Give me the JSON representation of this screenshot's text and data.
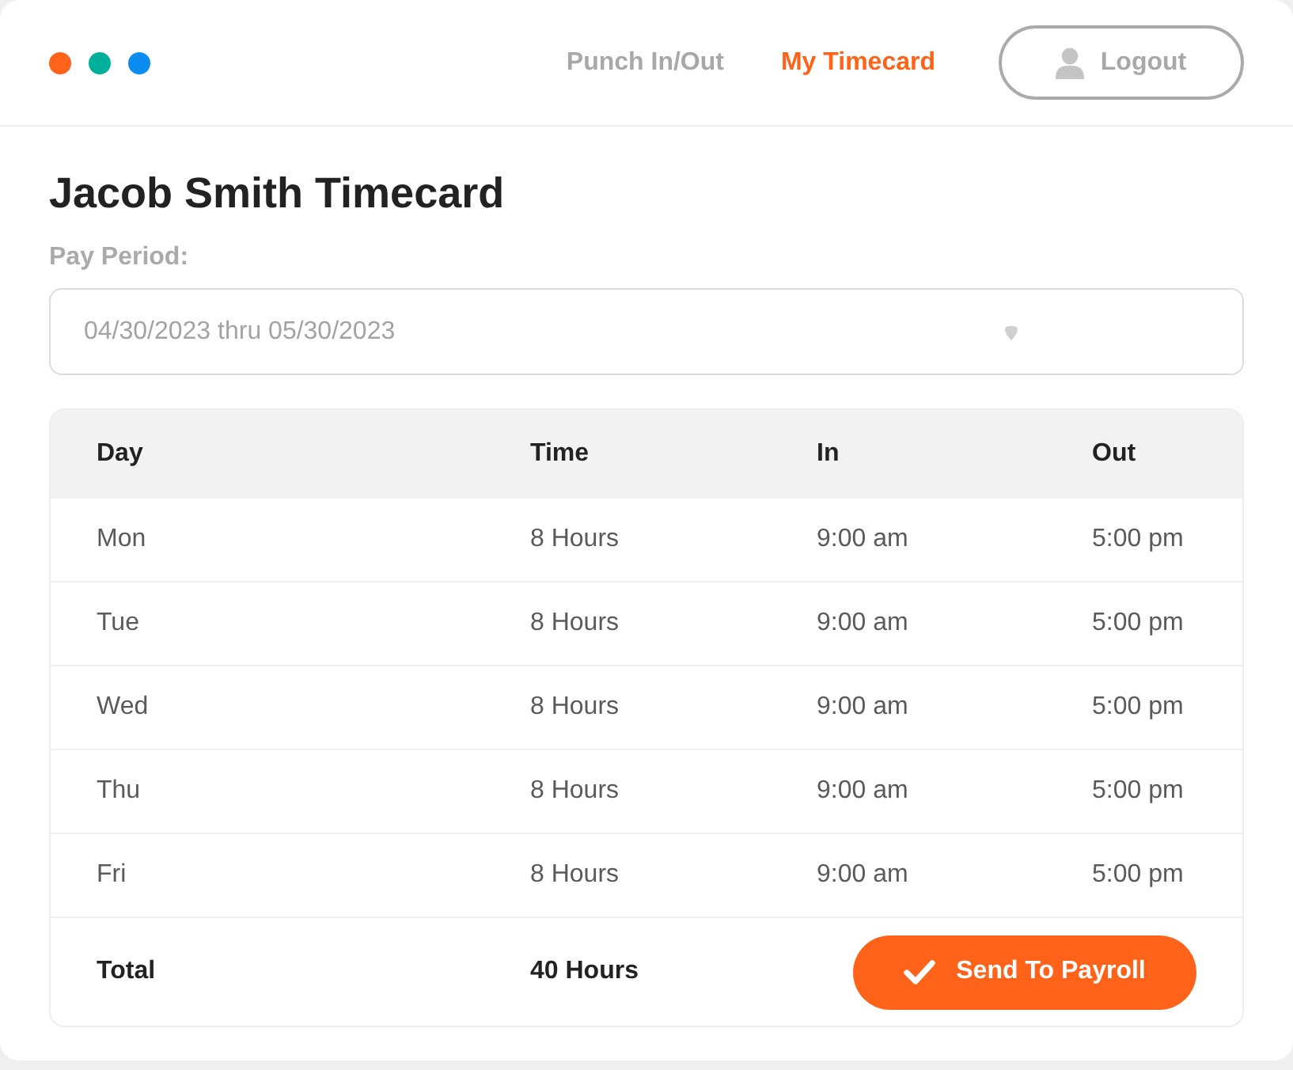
{
  "nav": {
    "items": [
      {
        "label": "Punch In/Out",
        "selected": false
      },
      {
        "label": "My Timecard",
        "selected": true
      }
    ],
    "logout": "Logout"
  },
  "page": {
    "title": "Jacob Smith Timecard"
  },
  "pay_period": {
    "label": "Pay Period:",
    "value": "04/30/2023 thru 05/30/2023"
  },
  "table": {
    "columns": [
      "Day",
      "Time",
      "In",
      "Out"
    ],
    "rows": [
      [
        "Mon",
        "8 Hours",
        "9:00 am",
        "5:00 pm"
      ],
      [
        "Tue",
        "8 Hours",
        "9:00 am",
        "5:00 pm"
      ],
      [
        "Wed",
        "8 Hours",
        "9:00 am",
        "5:00 pm"
      ],
      [
        "Thu",
        "8 Hours",
        "9:00 am",
        "5:00 pm"
      ],
      [
        "Fri",
        "8 Hours",
        "9:00 am",
        "5:00 pm"
      ]
    ],
    "total": {
      "label": "Total",
      "time": "40 Hours",
      "button": "Send To Payroll"
    }
  }
}
